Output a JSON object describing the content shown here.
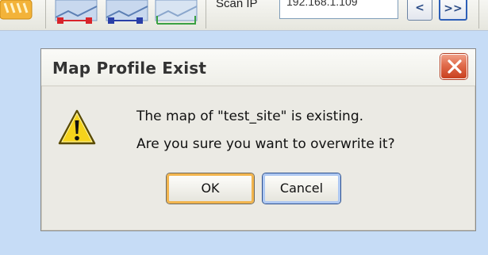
{
  "toolbar": {
    "scan_label": "Scan IP",
    "scan_input_value": "192.168.1.109",
    "nav_prev_label": "<",
    "nav_next_label": ">>"
  },
  "dialog": {
    "title": "Map Profile Exist",
    "message_line1": "The map of \"test_site\" is existing.",
    "message_line2": "Are you sure you want to overwrite it?",
    "ok_label": "OK",
    "cancel_label": "Cancel"
  },
  "icons": {
    "warning": "warning-icon",
    "close": "close-icon"
  },
  "colors": {
    "background": "#c6dcf6",
    "close_button": "#d9532f",
    "ok_focus": "#f2b54e",
    "cancel_focus": "#aec8f2",
    "warning_yellow": "#f5d31b"
  }
}
